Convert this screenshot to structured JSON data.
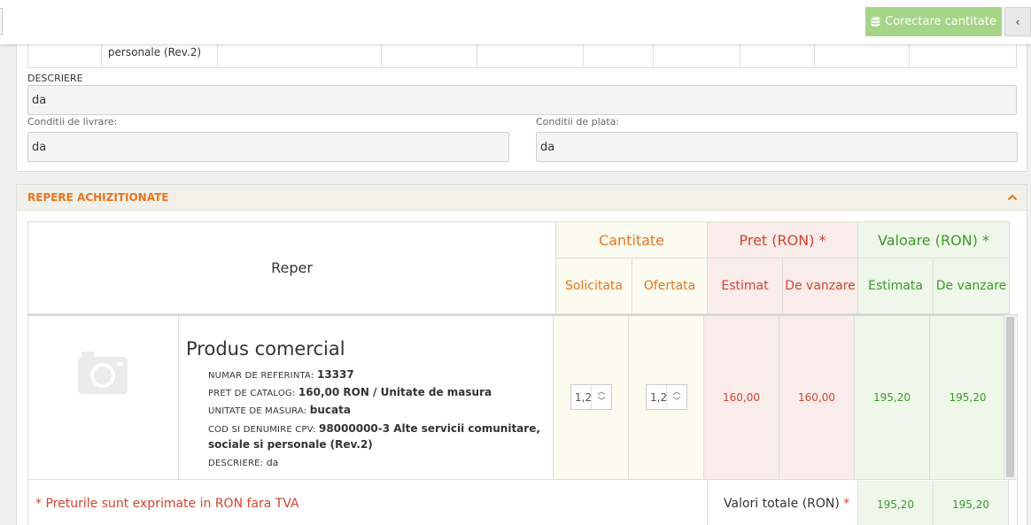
{
  "toolbar": {
    "corectare_label": "Corectare cantitate",
    "collapse_label": "‹"
  },
  "prev_row": {
    "cells": [
      "",
      "personale (Rev.2)",
      "",
      "",
      "",
      "",
      "",
      "",
      "",
      ""
    ]
  },
  "descriere": {
    "label": "DESCRIERE",
    "value": "da"
  },
  "livrare": {
    "label": "Conditii de livrare:",
    "value": "da"
  },
  "plata": {
    "label": "Conditii de plata:",
    "value": "da"
  },
  "repere": {
    "title": "REPERE ACHIZITIONATE",
    "headers": {
      "reper": "Reper",
      "cantitate": "Cantitate",
      "pret": "Pret (RON) *",
      "valoare": "Valoare (RON) *",
      "solicitata": "Solicitata",
      "ofertata": "Ofertata",
      "estimat": "Estimat",
      "de_vanzare_pret": "De vanzare",
      "estimata": "Estimata",
      "de_vanzare_val": "De vanzare"
    },
    "product": {
      "name": "Produs comercial",
      "ref_label": "NUMAR DE REFERINTA:",
      "ref_value": "13337",
      "pret_label": "PRET DE CATALOG:",
      "pret_value": "160,00  RON / Unitate de masura",
      "um_label": "UNITATE DE MASURA:",
      "um_value": "bucata",
      "cpv_label": "COD SI DENUMIRE CPV:",
      "cpv_value": "98000000-3 Alte servicii comunitare, sociale si personale (Rev.2)",
      "desc_label": "DESCRIERE:",
      "desc_value": "da",
      "solicitata": "1,2",
      "ofertata": "1,2",
      "pret_estimat": "160,00",
      "pret_vanzare": "160,00",
      "val_estimata": "195,20",
      "val_vanzare": "195,20"
    },
    "footer": {
      "note": "* Preturile sunt exprimate in RON fara TVA",
      "totals_label": "Valori totale (RON)",
      "totals_star": "*",
      "total_estimata": "195,20",
      "total_vanzare": "195,20"
    }
  },
  "colors": {
    "accent_orange": "#e8741e",
    "price_red": "#d2432f",
    "value_green": "#3c9a2a",
    "button_green": "#a6d587"
  }
}
